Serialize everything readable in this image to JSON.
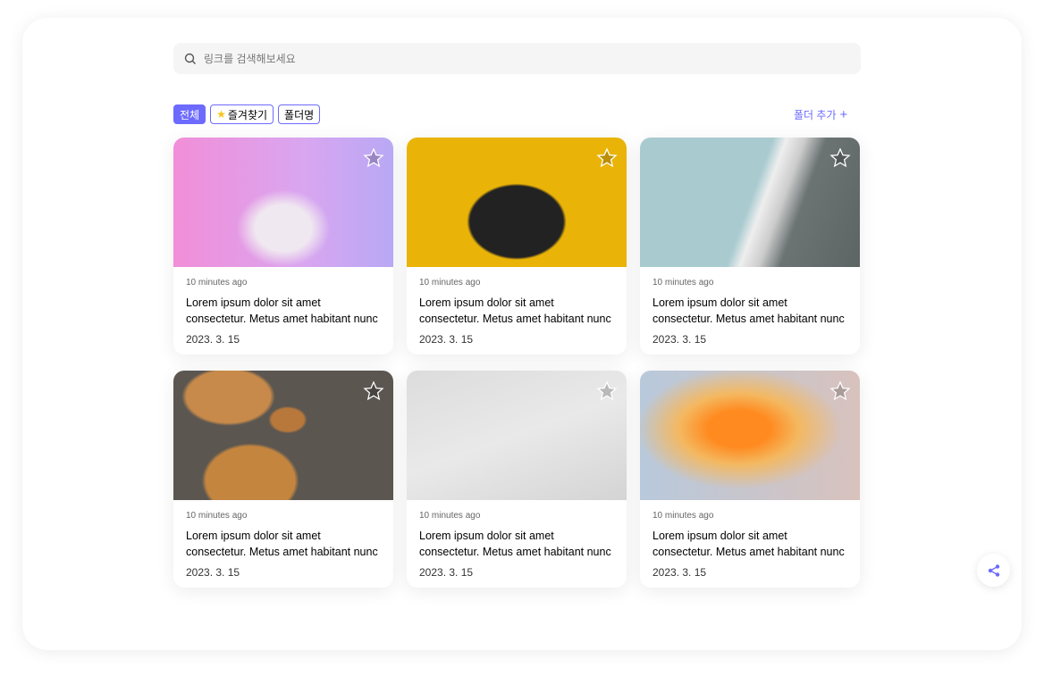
{
  "search": {
    "placeholder": "링크를 검색해보세요"
  },
  "folders": [
    {
      "label": "전체",
      "active": true
    },
    {
      "label": "즐겨찾기",
      "icon": "star-icon"
    },
    {
      "label": "폴더명"
    }
  ],
  "add_folder": {
    "label": "폴더 추가",
    "icon": "plus-icon"
  },
  "accent": "#6d6afe",
  "cards": [
    {
      "image": "pink car",
      "ago": "10 minutes ago",
      "desc": "Lorem ipsum dolor sit amet consectetur. Metus amet habitant nunc consequat....",
      "date": "2023. 3. 15"
    },
    {
      "image": "pug on yellow",
      "ago": "10 minutes ago",
      "desc": "Lorem ipsum dolor sit amet consectetur. Metus amet habitant nunc consequat....",
      "date": "2023. 3. 15"
    },
    {
      "image": "architecture",
      "ago": "10 minutes ago",
      "desc": "Lorem ipsum dolor sit amet consectetur. Metus amet habitant nunc consequat....",
      "date": "2023. 3. 15"
    },
    {
      "image": "lamps",
      "ago": "10 minutes ago",
      "desc": "Lorem ipsum dolor sit amet consectetur. Metus amet habitant nunc consequat....",
      "date": "2023. 3. 15"
    },
    {
      "image": "chair and table",
      "ago": "10 minutes ago",
      "desc": "Lorem ipsum dolor sit amet consectetur. Metus amet habitant nunc consequat....",
      "date": "2023. 3. 15"
    },
    {
      "image": "orange gradient",
      "ago": "10 minutes ago",
      "desc": "Lorem ipsum dolor sit amet consectetur. Metus amet habitant nunc consequat....",
      "date": "2023. 3. 15"
    }
  ]
}
